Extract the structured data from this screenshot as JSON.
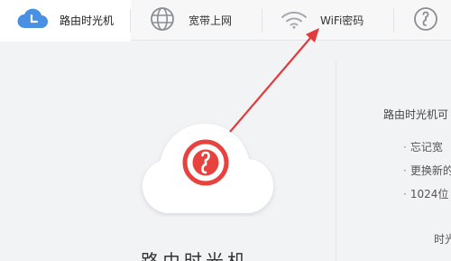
{
  "tabs": [
    {
      "label": "路由时光机",
      "icon": "clock-cloud-icon",
      "active": true
    },
    {
      "label": "宽带上网",
      "icon": "globe-icon",
      "active": false
    },
    {
      "label": "WiFi密码",
      "icon": "wifi-icon",
      "active": false
    },
    {
      "label": "",
      "icon": "power-icon",
      "active": false
    }
  ],
  "right_panel": {
    "title": "路由时光机可",
    "bullets": [
      "忘记宽",
      "更换新的",
      "1024位"
    ],
    "footer": "时光"
  },
  "hero": {
    "caption": "路由时光机"
  },
  "colors": {
    "accent": "#4a90e2",
    "hero_red": "#e8423f",
    "arrow_red": "#e03c3c"
  }
}
